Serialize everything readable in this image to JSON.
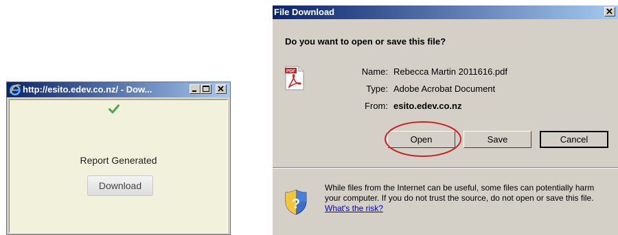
{
  "popup": {
    "title": "http://esito.edev.co.nz/ - Dow...",
    "status_text": "Report Generated",
    "download_label": "Download"
  },
  "dialog": {
    "title": "File Download",
    "question": "Do you want to open or save this file?",
    "name_label": "Name:",
    "name_value": "Rebecca Martin 2011616.pdf",
    "type_label": "Type:",
    "type_value": "Adobe Acrobat Document",
    "from_label": "From:",
    "from_value": "esito.edev.co.nz",
    "open_label": "Open",
    "save_label": "Save",
    "cancel_label": "Cancel",
    "warning_text": "While files from the Internet can be useful, some files can potentially harm your computer. If you do not trust the source, do not open or save this file.",
    "risk_link": "What's the risk?",
    "file_icon_text": "PDF"
  },
  "colors": {
    "titlebar_start": "#0a246a",
    "titlebar_end": "#a6caf0",
    "popup_body": "#f2f1dc",
    "highlight_circle": "#cc2222"
  }
}
